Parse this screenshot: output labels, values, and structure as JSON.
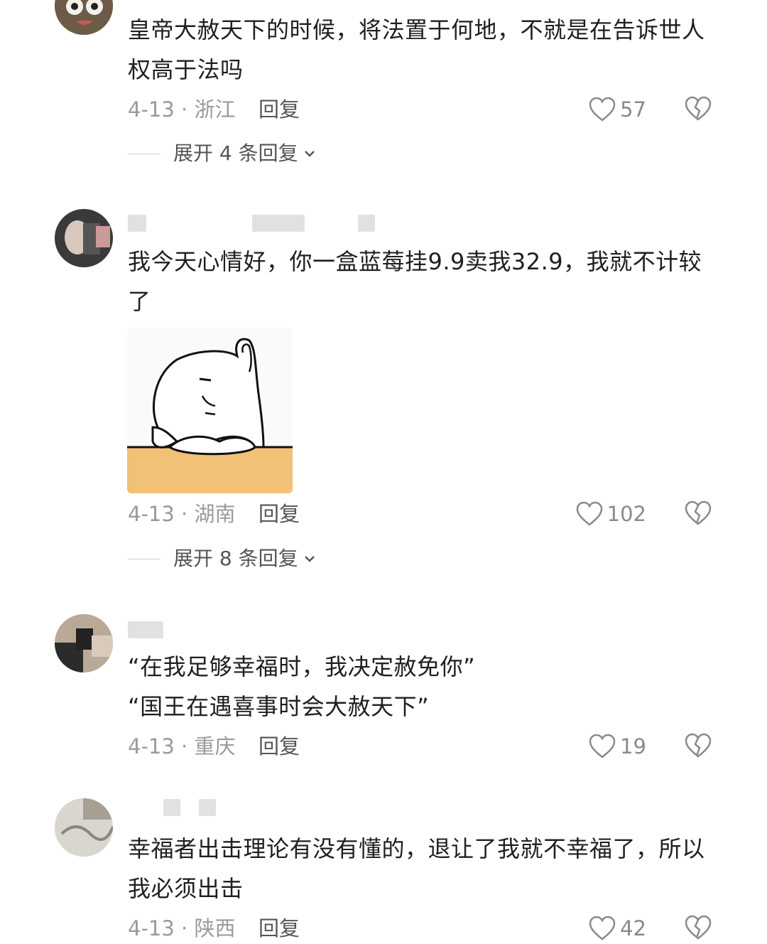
{
  "comments": [
    {
      "text": "皇帝大赦天下的时候，将法置于何地，不就是在告诉世人权高于法吗",
      "date_location": "4-13 · 浙江",
      "reply_label": "回复",
      "likes": "57",
      "expand_label": "展开 4 条回复"
    },
    {
      "text": "我今天心情好，你一盒蓝莓挂9.9卖我32.9，我就不计较了",
      "date_location": "4-13 · 湖南",
      "reply_label": "回复",
      "likes": "102",
      "expand_label": "展开 8 条回复"
    },
    {
      "text_line1": "“在我足够幸福时，我决定赦免你”",
      "text_line2": "“国王在遇喜事时会大赦天下”",
      "date_location": "4-13 · 重庆",
      "reply_label": "回复",
      "likes": "19"
    },
    {
      "text": "幸福者出击理论有没有懂的，退让了我就不幸福了，所以我必须出击",
      "date_location": "4-13 · 陕西",
      "reply_label": "回复",
      "likes": "42"
    }
  ],
  "colors": {
    "text": "#1f1f1f",
    "meta": "#9a9a9a",
    "icon": "#8a8a8a",
    "sticker_table": "#f2c178"
  }
}
